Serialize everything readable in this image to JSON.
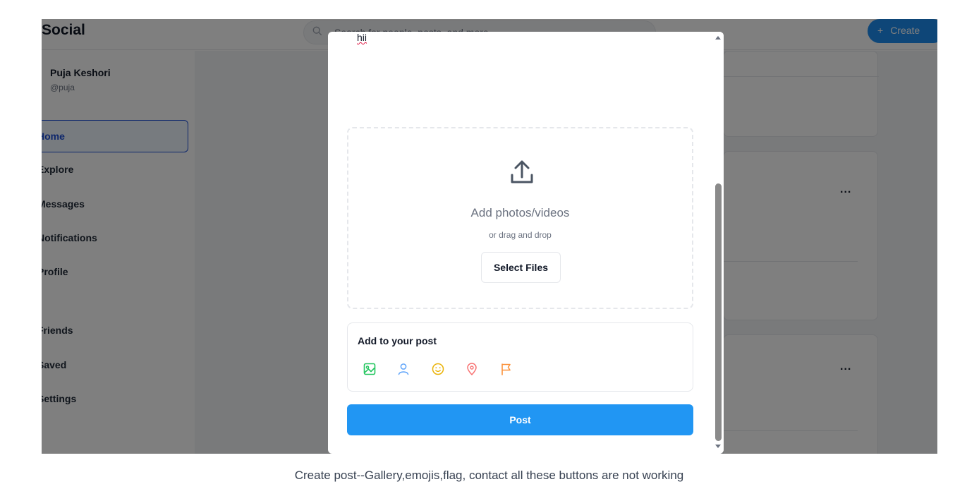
{
  "app": {
    "brand": "Social",
    "search_placeholder": "Search for people, posts, and more...",
    "create_label": "Create",
    "create_icon": "plus-icon"
  },
  "user": {
    "name": "Puja Keshori",
    "handle": "@puja"
  },
  "sidebar": {
    "items": [
      {
        "label": "Home",
        "active": true
      },
      {
        "label": "Explore"
      },
      {
        "label": "Messages"
      },
      {
        "label": "Notifications"
      },
      {
        "label": "Profile"
      },
      {
        "label": "Friends"
      },
      {
        "label": "Saved"
      },
      {
        "label": "Settings"
      }
    ]
  },
  "feed": {
    "more_label": "..."
  },
  "modal": {
    "post_text": "hii",
    "dropzone": {
      "icon": "upload-icon",
      "title": "Add photos/videos",
      "subtitle": "or drag and drop",
      "select_label": "Select Files"
    },
    "add_to_post": {
      "title": "Add to your post",
      "tools": [
        {
          "name": "gallery-icon",
          "color": "#22c55e"
        },
        {
          "name": "tag-person-icon",
          "color": "#60a5fa"
        },
        {
          "name": "emoji-icon",
          "color": "#eab308"
        },
        {
          "name": "location-icon",
          "color": "#f87171"
        },
        {
          "name": "flag-icon",
          "color": "#fb923c"
        }
      ]
    },
    "post_label": "Post",
    "accent": "#2196f3"
  },
  "caption": "Create post--Gallery,emojis,flag, contact all these buttons are not working"
}
